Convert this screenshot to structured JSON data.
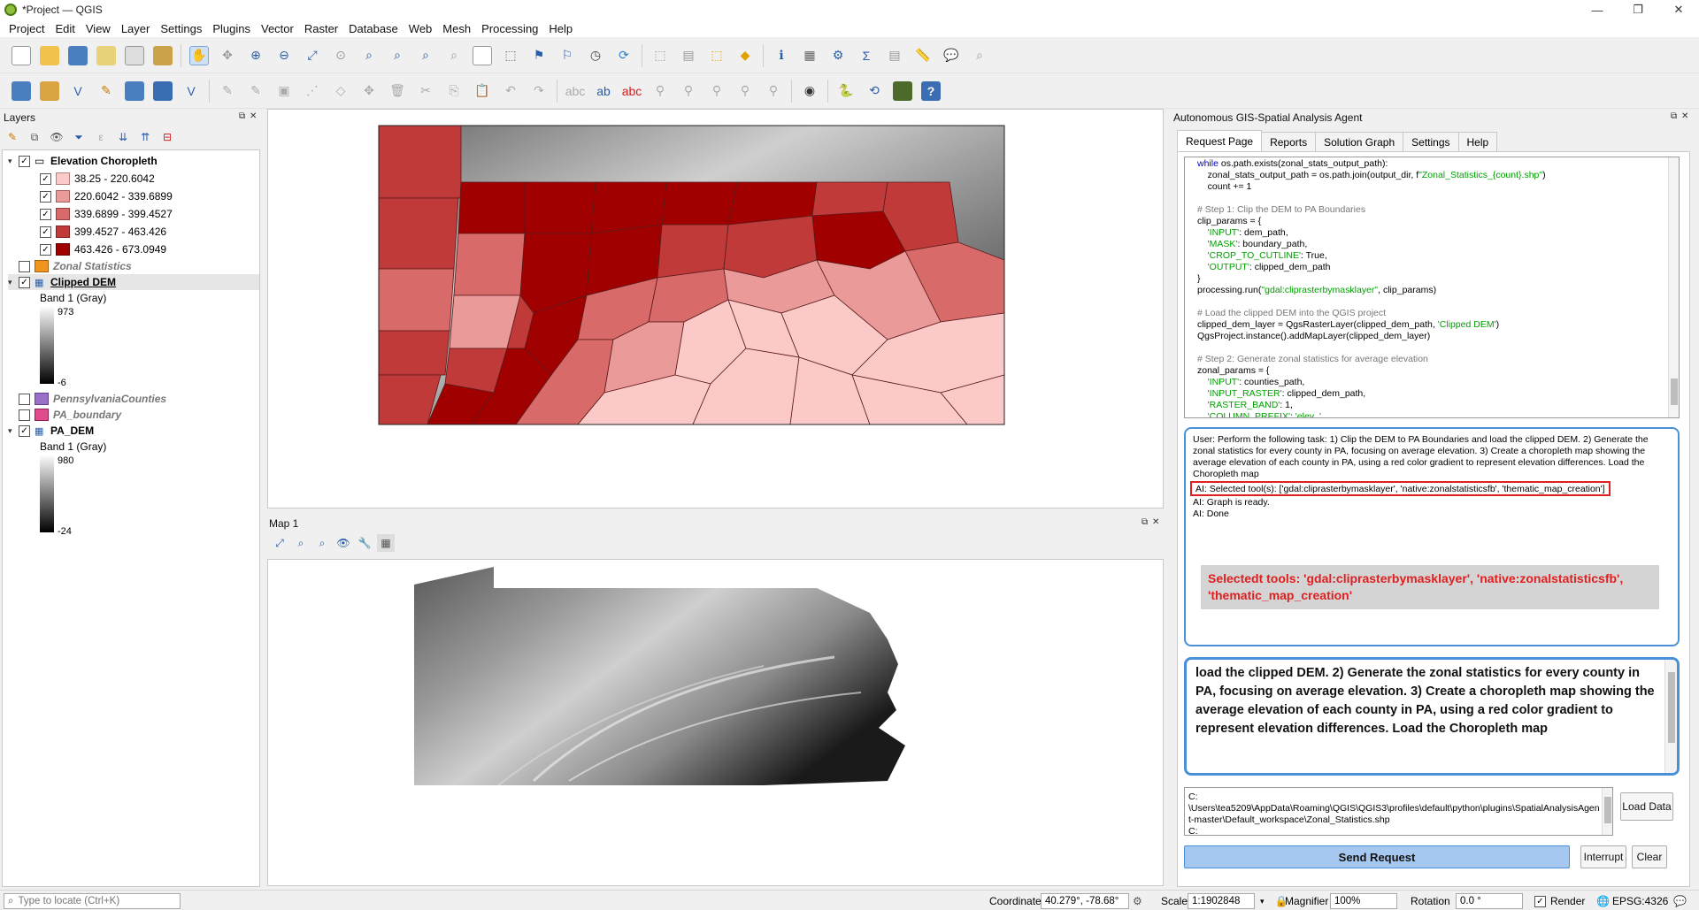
{
  "window": {
    "title": "*Project — QGIS",
    "controls": [
      "—",
      "❐",
      "✕"
    ]
  },
  "menu": [
    "Project",
    "Edit",
    "View",
    "Layer",
    "Settings",
    "Plugins",
    "Vector",
    "Raster",
    "Database",
    "Web",
    "Mesh",
    "Processing",
    "Help"
  ],
  "layers_panel": {
    "title": "Layers",
    "groups": [
      {
        "name": "Elevation Choropleth",
        "checked": true,
        "classes": [
          {
            "label": "38.25 - 220.6042",
            "color": "#fcc9c9"
          },
          {
            "label": "220.6042 - 339.6899",
            "color": "#eb9a9a"
          },
          {
            "label": "339.6899 - 399.4527",
            "color": "#d86a6a"
          },
          {
            "label": "399.4527 - 463.426",
            "color": "#c13a3a"
          },
          {
            "label": "463.426 - 673.0949",
            "color": "#a00000"
          }
        ]
      },
      {
        "name": "Zonal Statistics",
        "checked": false,
        "color": "#f0961e"
      },
      {
        "name": "Clipped DEM",
        "checked": true,
        "band": "Band 1 (Gray)",
        "max": "973",
        "min": "-6"
      },
      {
        "name": "PennsylvaniaCounties",
        "checked": false,
        "color": "#9a6fc7"
      },
      {
        "name": "PA_boundary",
        "checked": false,
        "color": "#e04d8c"
      },
      {
        "name": "PA_DEM",
        "checked": true,
        "band": "Band 1 (Gray)",
        "max": "980",
        "min": "-24"
      }
    ]
  },
  "map1": {
    "title": "Map 1"
  },
  "agent": {
    "title": "Autonomous GIS-Spatial Analysis Agent",
    "tabs": [
      "Request Page",
      "Reports",
      "Solution Graph",
      "Settings",
      "Help"
    ],
    "log": {
      "user": "User: Perform the following task: 1) Clip the DEM to PA Boundaries and load the clipped DEM. 2) Generate the zonal statistics for every county in PA, focusing on average elevation. 3) Create a choropleth map showing the average elevation of each county in PA, using a red color gradient to represent elevation differences. Load the Choropleth map",
      "selected": "AI: Selected tool(s): ['gdal:cliprasterbymasklayer', 'native:zonalstatisticsfb', 'thematic_map_creation']",
      "graph": "AI: Graph is ready.",
      "done": "AI: Done",
      "callout": "Selectedt tools: 'gdal:cliprasterbymasklayer', 'native:zonalstatisticsfb', 'thematic_map_creation'"
    },
    "prompt": "load the clipped DEM. 2) Generate the zonal statistics for every county in PA, focusing on average elevation. 3) Create a choropleth map showing the average elevation of each county in PA, using a red color gradient to represent elevation differences. Load the Choropleth map",
    "path_line1": "C:",
    "path_line2": "\\Users\\tea5209\\AppData\\Roaming\\QGIS\\QGIS3\\profiles\\default\\python\\plugins\\SpatialAnalysisAgent-master\\Default_workspace\\Zonal_Statistics.shp",
    "path_line3": "C:",
    "buttons": {
      "load_data": "Load Data",
      "send": "Send Request",
      "interrupt": "Interrupt",
      "clear": "Clear"
    }
  },
  "status": {
    "locate_placeholder": "Type to locate (Ctrl+K)",
    "coordinate_label": "Coordinate",
    "coordinate": "40.279°, -78.68°",
    "scale_label": "Scale",
    "scale": "1:1902848",
    "magnifier_label": "Magnifier",
    "magnifier": "100%",
    "rotation_label": "Rotation",
    "rotation": "0.0 °",
    "render_label": "Render",
    "crs": "EPSG:4326"
  }
}
